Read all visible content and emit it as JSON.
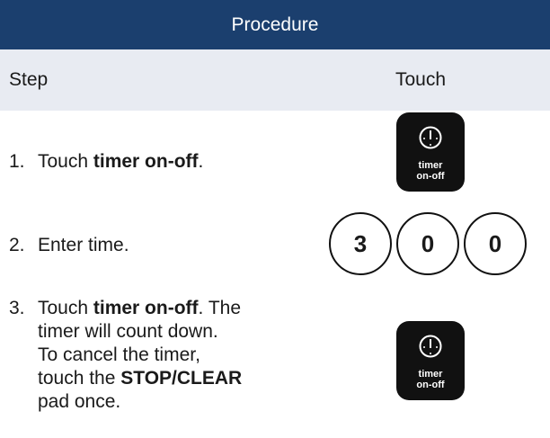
{
  "header": {
    "title": "Procedure"
  },
  "columns": {
    "step": "Step",
    "touch": "Touch"
  },
  "steps": [
    {
      "number": "1.",
      "pre": "Touch ",
      "bold": "timer on-off",
      "post": "."
    },
    {
      "number": "2.",
      "text": "Enter time."
    },
    {
      "number": "3.",
      "line1_pre": "Touch ",
      "line1_bold": "timer on-off",
      "line1_post": ". The",
      "line2": "timer will count down.",
      "line3": "To cancel the timer,",
      "line4_pre": "touch the ",
      "line4_bold": "STOP/CLEAR",
      "line5": "pad once."
    }
  ],
  "keypad": {
    "icon": "clock-icon",
    "label_line1": "timer",
    "label_line2": "on-off"
  },
  "digits": [
    "3",
    "0",
    "0"
  ]
}
